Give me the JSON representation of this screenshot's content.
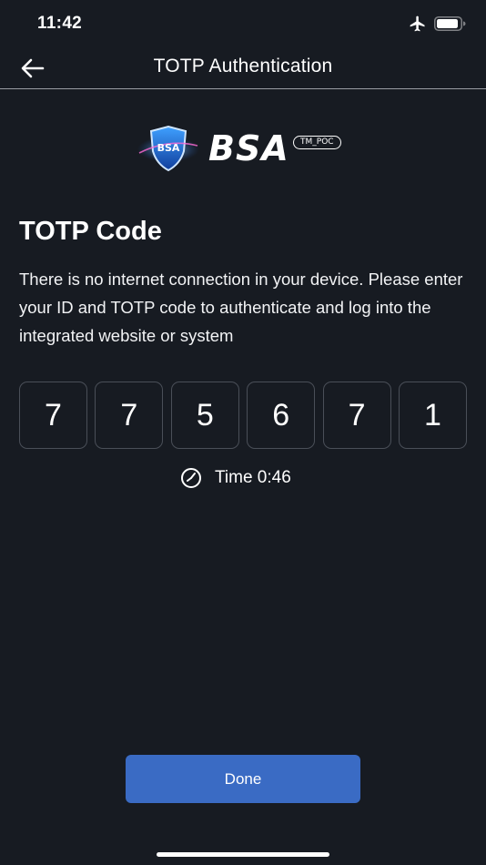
{
  "status_bar": {
    "time": "11:42",
    "icons": [
      "airplane-icon",
      "battery-icon"
    ]
  },
  "nav": {
    "title": "TOTP Authentication",
    "back_icon": "arrow-left-icon"
  },
  "logo": {
    "shield_text": "BSA",
    "wordmark": "BSA",
    "badge": "TM_POC"
  },
  "content": {
    "heading": "TOTP Code",
    "description": "There is no internet connection in your device. Please enter your ID and TOTP code to authenticate and log into the integrated website or system",
    "code_digits": [
      "7",
      "7",
      "5",
      "6",
      "7",
      "1"
    ],
    "timer": {
      "icon": "clock-icon",
      "text": "Time 0:46"
    }
  },
  "actions": {
    "done_label": "Done"
  },
  "colors": {
    "background": "#171b22",
    "primary_button": "#3a6bc4",
    "code_border": "#4a4f58",
    "text": "#ffffff"
  }
}
